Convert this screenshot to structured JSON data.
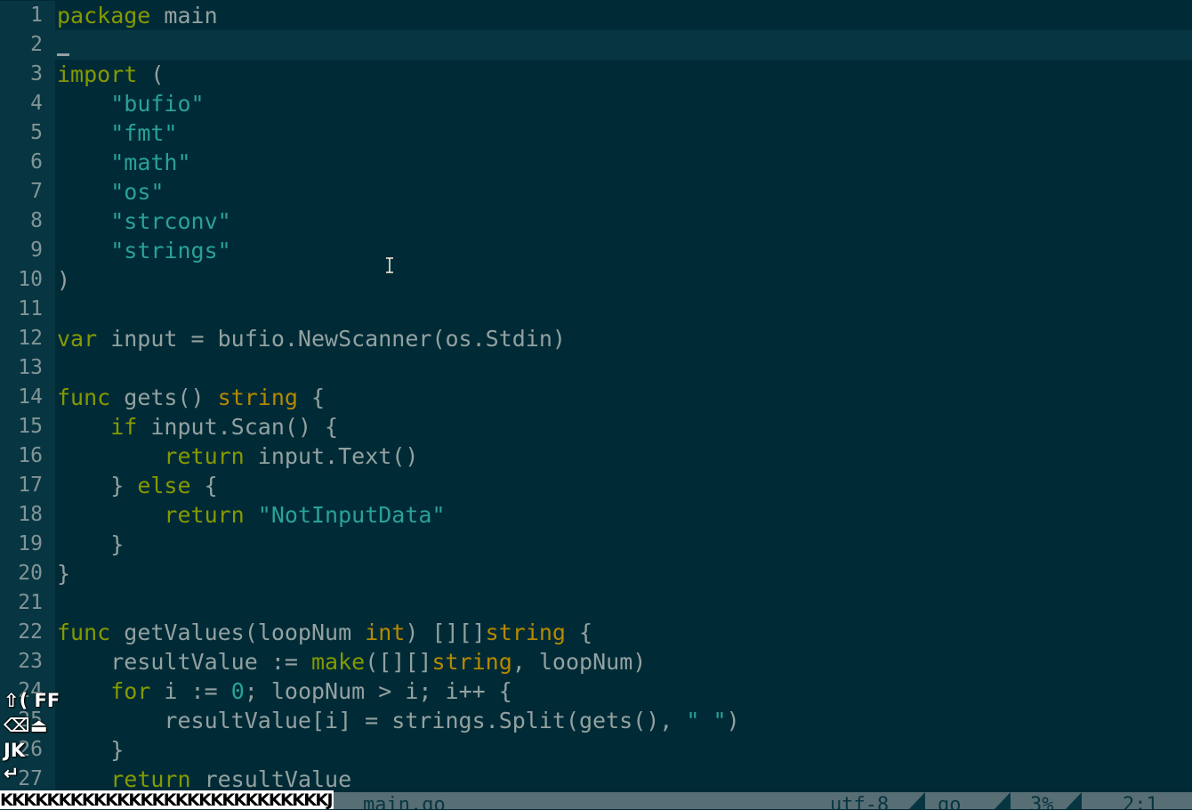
{
  "editor": {
    "current_line": 2,
    "lines": [
      {
        "num": "1",
        "tokens": [
          {
            "t": "package",
            "c": "kw"
          },
          {
            "t": " main",
            "c": "txt"
          }
        ]
      },
      {
        "num": "2",
        "tokens": []
      },
      {
        "num": "3",
        "tokens": [
          {
            "t": "import",
            "c": "kw"
          },
          {
            "t": " (",
            "c": "txt"
          }
        ]
      },
      {
        "num": "4",
        "tokens": [
          {
            "t": "    ",
            "c": "txt"
          },
          {
            "t": "\"bufio\"",
            "c": "str"
          }
        ]
      },
      {
        "num": "5",
        "tokens": [
          {
            "t": "    ",
            "c": "txt"
          },
          {
            "t": "\"fmt\"",
            "c": "str"
          }
        ]
      },
      {
        "num": "6",
        "tokens": [
          {
            "t": "    ",
            "c": "txt"
          },
          {
            "t": "\"math\"",
            "c": "str"
          }
        ]
      },
      {
        "num": "7",
        "tokens": [
          {
            "t": "    ",
            "c": "txt"
          },
          {
            "t": "\"os\"",
            "c": "str"
          }
        ]
      },
      {
        "num": "8",
        "tokens": [
          {
            "t": "    ",
            "c": "txt"
          },
          {
            "t": "\"strconv\"",
            "c": "str"
          }
        ]
      },
      {
        "num": "9",
        "tokens": [
          {
            "t": "    ",
            "c": "txt"
          },
          {
            "t": "\"strings\"",
            "c": "str"
          }
        ]
      },
      {
        "num": "10",
        "tokens": [
          {
            "t": ")",
            "c": "txt"
          }
        ]
      },
      {
        "num": "11",
        "tokens": []
      },
      {
        "num": "12",
        "tokens": [
          {
            "t": "var",
            "c": "kw"
          },
          {
            "t": " input = bufio.NewScanner(os.Stdin)",
            "c": "txt"
          }
        ]
      },
      {
        "num": "13",
        "tokens": []
      },
      {
        "num": "14",
        "tokens": [
          {
            "t": "func",
            "c": "kw"
          },
          {
            "t": " gets() ",
            "c": "txt"
          },
          {
            "t": "string",
            "c": "typ"
          },
          {
            "t": " {",
            "c": "txt"
          }
        ]
      },
      {
        "num": "15",
        "tokens": [
          {
            "t": "    ",
            "c": "txt"
          },
          {
            "t": "if",
            "c": "kw"
          },
          {
            "t": " input.Scan() {",
            "c": "txt"
          }
        ]
      },
      {
        "num": "16",
        "tokens": [
          {
            "t": "        ",
            "c": "txt"
          },
          {
            "t": "return",
            "c": "kw"
          },
          {
            "t": " input.Text()",
            "c": "txt"
          }
        ]
      },
      {
        "num": "17",
        "tokens": [
          {
            "t": "    } ",
            "c": "txt"
          },
          {
            "t": "else",
            "c": "kw"
          },
          {
            "t": " {",
            "c": "txt"
          }
        ]
      },
      {
        "num": "18",
        "tokens": [
          {
            "t": "        ",
            "c": "txt"
          },
          {
            "t": "return",
            "c": "kw"
          },
          {
            "t": " ",
            "c": "txt"
          },
          {
            "t": "\"NotInputData\"",
            "c": "str"
          }
        ]
      },
      {
        "num": "19",
        "tokens": [
          {
            "t": "    }",
            "c": "txt"
          }
        ]
      },
      {
        "num": "20",
        "tokens": [
          {
            "t": "}",
            "c": "txt"
          }
        ]
      },
      {
        "num": "21",
        "tokens": []
      },
      {
        "num": "22",
        "tokens": [
          {
            "t": "func",
            "c": "kw"
          },
          {
            "t": " getValues(loopNum ",
            "c": "txt"
          },
          {
            "t": "int",
            "c": "typ"
          },
          {
            "t": ") [][]",
            "c": "txt"
          },
          {
            "t": "string",
            "c": "typ"
          },
          {
            "t": " {",
            "c": "txt"
          }
        ]
      },
      {
        "num": "23",
        "tokens": [
          {
            "t": "    resultValue := ",
            "c": "txt"
          },
          {
            "t": "make",
            "c": "fn"
          },
          {
            "t": "([][]",
            "c": "txt"
          },
          {
            "t": "string",
            "c": "typ"
          },
          {
            "t": ", loopNum)",
            "c": "txt"
          }
        ]
      },
      {
        "num": "24",
        "tokens": [
          {
            "t": "    ",
            "c": "txt"
          },
          {
            "t": "for",
            "c": "kw"
          },
          {
            "t": " i := ",
            "c": "txt"
          },
          {
            "t": "0",
            "c": "num"
          },
          {
            "t": "; loopNum > i; i++ {",
            "c": "txt"
          }
        ]
      },
      {
        "num": "25",
        "tokens": [
          {
            "t": "        resultValue[i] = strings.Split(gets(), ",
            "c": "txt"
          },
          {
            "t": "\" \"",
            "c": "str"
          },
          {
            "t": ")",
            "c": "txt"
          }
        ]
      },
      {
        "num": "26",
        "tokens": [
          {
            "t": "    }",
            "c": "txt"
          }
        ]
      },
      {
        "num": "27",
        "tokens": [
          {
            "t": "    ",
            "c": "txt"
          },
          {
            "t": "return",
            "c": "kw"
          },
          {
            "t": " resultValue",
            "c": "txt"
          }
        ]
      }
    ]
  },
  "status_bar": {
    "filename": "main.go",
    "encoding": "utf-8",
    "filetype": "go",
    "percent": "3%",
    "position": "2:1"
  },
  "key_overlay": {
    "line1": "⇧( FF",
    "line2": "⌫⏏",
    "line3": "JK",
    "line4": "↵",
    "strip": "KKKKKKKKKKKKKKKKKKKKKKKKKKKKJ"
  },
  "colors": {
    "background": "#002b36",
    "gutter": "#073642",
    "keyword": "#859900",
    "type": "#b58900",
    "string": "#2aa198",
    "text": "#93a1a1"
  }
}
